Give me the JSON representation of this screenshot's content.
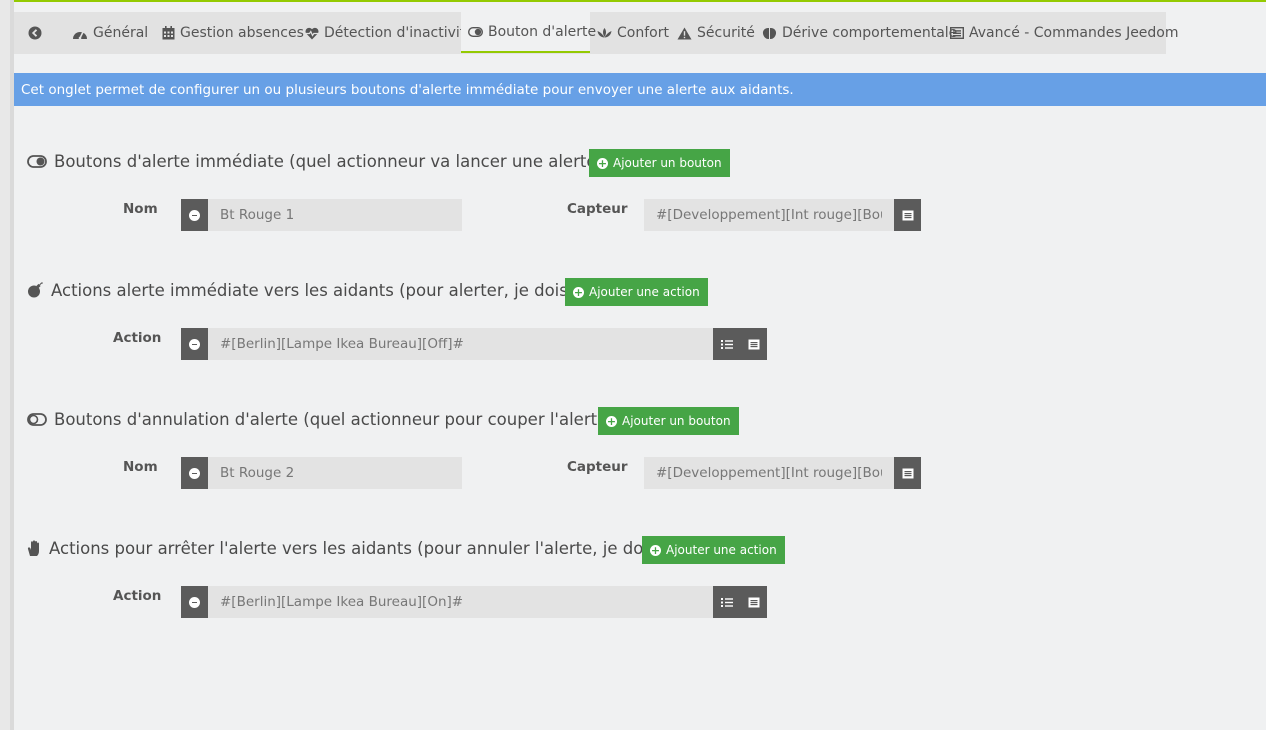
{
  "tabs": [
    {
      "label": ""
    },
    {
      "label": "Général"
    },
    {
      "label": "Gestion absences"
    },
    {
      "label": "Détection d'inactivité"
    },
    {
      "label": "Bouton d'alerte"
    },
    {
      "label": "Confort"
    },
    {
      "label": "Sécurité"
    },
    {
      "label": "Dérive comportementale"
    },
    {
      "label": "Avancé - Commandes Jeedom"
    }
  ],
  "info": "Cet onglet permet de configurer un ou plusieurs boutons d'alerte immédiate pour envoyer une alerte aux aidants.",
  "sections": {
    "alert_buttons": {
      "title": "Boutons d'alerte immédiate (quel actionneur va lancer une alerte ?)",
      "add_label": "Ajouter un bouton",
      "name_label": "Nom",
      "name_value": "Bt Rouge 1",
      "sensor_label": "Capteur",
      "sensor_value": "#[Developpement][Int rouge][Bouton"
    },
    "alert_actions": {
      "title": "Actions alerte immédiate vers les aidants (pour alerter, je dois ?)",
      "add_label": "Ajouter une action",
      "action_label": "Action",
      "action_value": "#[Berlin][Lampe Ikea Bureau][Off]#"
    },
    "cancel_buttons": {
      "title": "Boutons d'annulation d'alerte (quel actionneur pour couper l'alerte ?)",
      "add_label": "Ajouter un bouton",
      "name_label": "Nom",
      "name_value": "Bt Rouge 2",
      "sensor_label": "Capteur",
      "sensor_value": "#[Developpement][Int rouge][Bouton"
    },
    "cancel_actions": {
      "title": "Actions pour arrêter l'alerte vers les aidants (pour annuler l'alerte, je dois ?)",
      "add_label": "Ajouter une action",
      "action_label": "Action",
      "action_value": "#[Berlin][Lampe Ikea Bureau][On]#"
    }
  },
  "colors": {
    "accent": "#94ca02",
    "info_bar": "#67a0e6",
    "add_button": "#46a546",
    "dark_button": "#5b5b5b"
  }
}
